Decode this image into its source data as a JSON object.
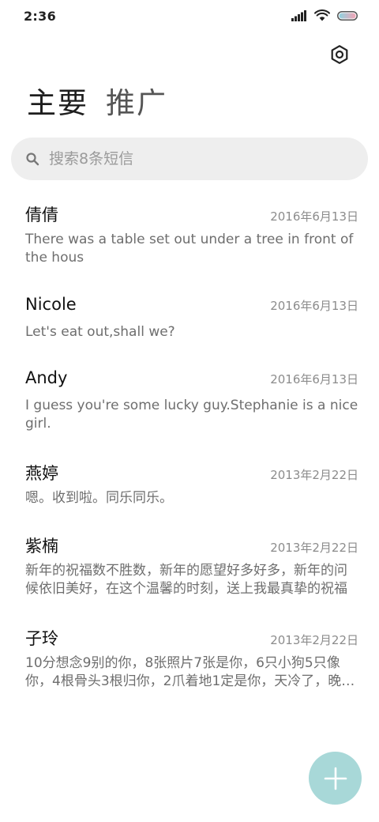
{
  "status_bar": {
    "time": "2:36",
    "icons": [
      "signal-icon",
      "wifi-icon",
      "battery-icon"
    ]
  },
  "header": {
    "settings_icon": "gear-icon",
    "tabs": [
      {
        "label": "主要",
        "active": true
      },
      {
        "label": "推广",
        "active": false
      }
    ]
  },
  "search": {
    "icon": "search-icon",
    "placeholder": "搜索8条短信"
  },
  "threads": [
    {
      "name": "倩倩",
      "date": "2016年6月13日",
      "preview": "There was a table set out under a tree in front of the hous"
    },
    {
      "name": "Nicole",
      "date": "2016年6月13日",
      "preview": "Let's eat out,shall we?"
    },
    {
      "name": "Andy",
      "date": "2016年6月13日",
      "preview": "I guess you're some lucky guy.Stephanie is a nice girl."
    },
    {
      "name": "燕婷",
      "date": "2013年2月22日",
      "preview": "嗯。收到啦。同乐同乐。"
    },
    {
      "name": "紫楠",
      "date": "2013年2月22日",
      "preview": "新年的祝福数不胜数，新年的愿望好多好多，新年的问候依旧美好，在这个温馨的时刻，送上我最真挚的祝福"
    },
    {
      "name": "子玲",
      "date": "2013年2月22日",
      "preview": "10分想念9别的你，8张照片7张是你，6只小狗5只像你，4根骨头3根归你，2爪着地1定是你，天冷了，晚上记得盖被子"
    }
  ],
  "fab": {
    "icon": "plus-icon"
  },
  "colors": {
    "fab": "#a8d8d8",
    "search_bg": "#eeeeee",
    "date_text": "#8c8c8c",
    "preview_text": "#6e6e6e"
  }
}
